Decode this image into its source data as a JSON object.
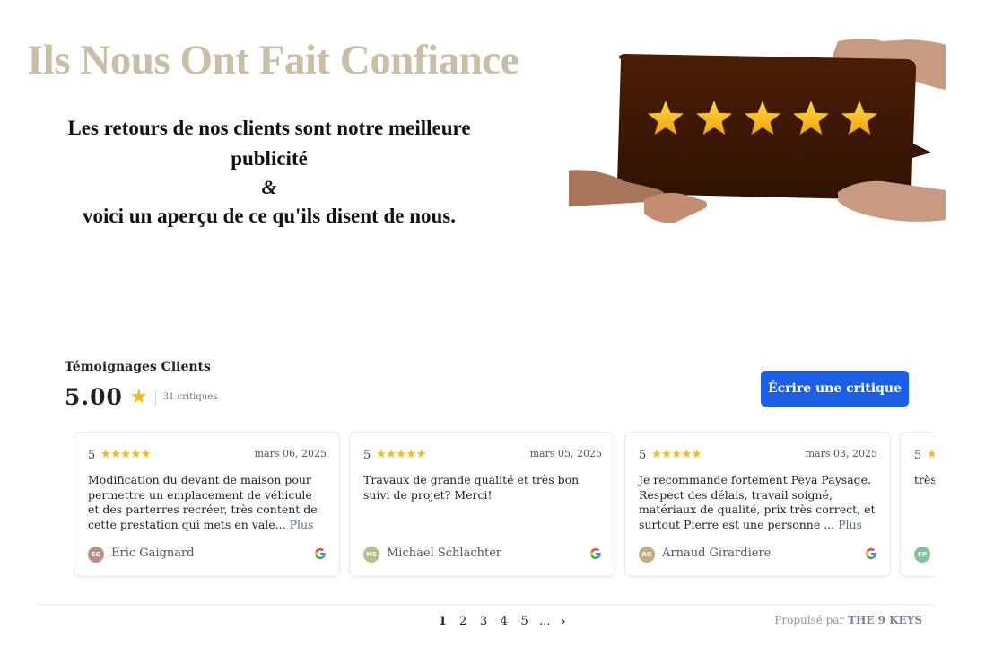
{
  "hero": {
    "title": "Ils Nous Ont Fait Confiance",
    "line1": "Les retours de nos clients sont notre meilleure publicité",
    "ampersand": "&",
    "line2": "voici un aperçu de ce qu'ils disent de nous."
  },
  "widget": {
    "title": "Témoignages Clients",
    "rating": "5.00",
    "count": "31 critiques",
    "write_button": "Écrire une critique",
    "colors": {
      "accent": "#1a5fe6",
      "star": "#f5b71a"
    }
  },
  "reviews": [
    {
      "score": "5",
      "stars": "★★★★★",
      "date": "mars 06, 2025",
      "text": "Modification du devant de maison pour permettre un emplacement de véhicule et des parterres recréer, très content de cette prestation qui mets en vale...",
      "more": "Plus",
      "initials": "EG",
      "author": "Eric Gaignard",
      "avatar_color": "#b8908a"
    },
    {
      "score": "5",
      "stars": "★★★★★",
      "date": "mars 05, 2025",
      "text": "Travaux de grande qualité et très bon suivi de projet? Merci!",
      "more": "",
      "initials": "MS",
      "author": "Michael Schlachter",
      "avatar_color": "#b3c088"
    },
    {
      "score": "5",
      "stars": "★★★★★",
      "date": "mars 03, 2025",
      "text": "Je recommande fortement Peya Paysage. Respect des délais, travail soigné, matériaux de qualité, prix très correct, et surtout Pierre est une personne ...",
      "more": "Plus",
      "initials": "AG",
      "author": "Arnaud Girardiere",
      "avatar_color": "#c2ac85"
    },
    {
      "score": "5",
      "stars": "★★★★★",
      "date": "",
      "text": "très une",
      "more": "",
      "initials": "FP",
      "author": "",
      "avatar_color": "#88c09a"
    }
  ],
  "pagination": {
    "pages": [
      "1",
      "2",
      "3",
      "4",
      "5",
      "..."
    ],
    "current": "1",
    "next": "›"
  },
  "footer": {
    "powered_prefix": "Propulsé par",
    "powered_brand": "THE 9 KEYS"
  }
}
